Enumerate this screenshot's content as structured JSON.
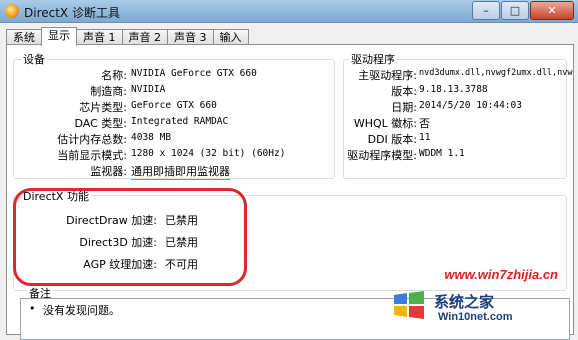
{
  "window": {
    "title": "DirectX 诊断工具"
  },
  "tabs": [
    {
      "label": "系统"
    },
    {
      "label": "显示"
    },
    {
      "label": "声音 1"
    },
    {
      "label": "声音 2"
    },
    {
      "label": "声音 3"
    },
    {
      "label": "输入"
    }
  ],
  "device": {
    "title": "设备",
    "rows": [
      {
        "label": "名称:",
        "value": "NVIDIA GeForce GTX 660"
      },
      {
        "label": "制造商:",
        "value": "NVIDIA"
      },
      {
        "label": "芯片类型:",
        "value": "GeForce GTX 660"
      },
      {
        "label": "DAC 类型:",
        "value": "Integrated RAMDAC"
      },
      {
        "label": "估计内存总数:",
        "value": "4038 MB"
      },
      {
        "label": "当前显示模式:",
        "value": "1280 x 1024 (32 bit) (60Hz)"
      },
      {
        "label": "监视器:",
        "value": "通用即插即用监视器"
      }
    ]
  },
  "driver": {
    "title": "驱动程序",
    "rows": [
      {
        "label": "主驱动程序:",
        "value": "nvd3dumx.dll,nvwgf2umx.dll,nvw"
      },
      {
        "label": "版本:",
        "value": "9.18.13.3788"
      },
      {
        "label": "日期:",
        "value": "2014/5/20 10:44:03"
      },
      {
        "label": "WHQL 徽标:",
        "value": "否"
      },
      {
        "label": "DDI 版本:",
        "value": "11"
      },
      {
        "label": "驱动程序模型:",
        "value": "WDDM 1.1"
      }
    ]
  },
  "directx": {
    "title": "DirectX 功能",
    "rows": [
      {
        "label": "DirectDraw 加速:",
        "value": "已禁用"
      },
      {
        "label": "Direct3D 加速:",
        "value": "已禁用"
      },
      {
        "label": "AGP 纹理加速:",
        "value": "不可用"
      }
    ]
  },
  "notes": {
    "title": "备注",
    "bullet": "•",
    "items": [
      "没有发现问题。"
    ]
  },
  "watermark": {
    "site": "www.win7zhijia.cn",
    "brand": "系统之家",
    "brand_site": "Win10net.com"
  },
  "colors": {
    "highlight": "#d9292f",
    "watermark_red": "#e02020"
  }
}
